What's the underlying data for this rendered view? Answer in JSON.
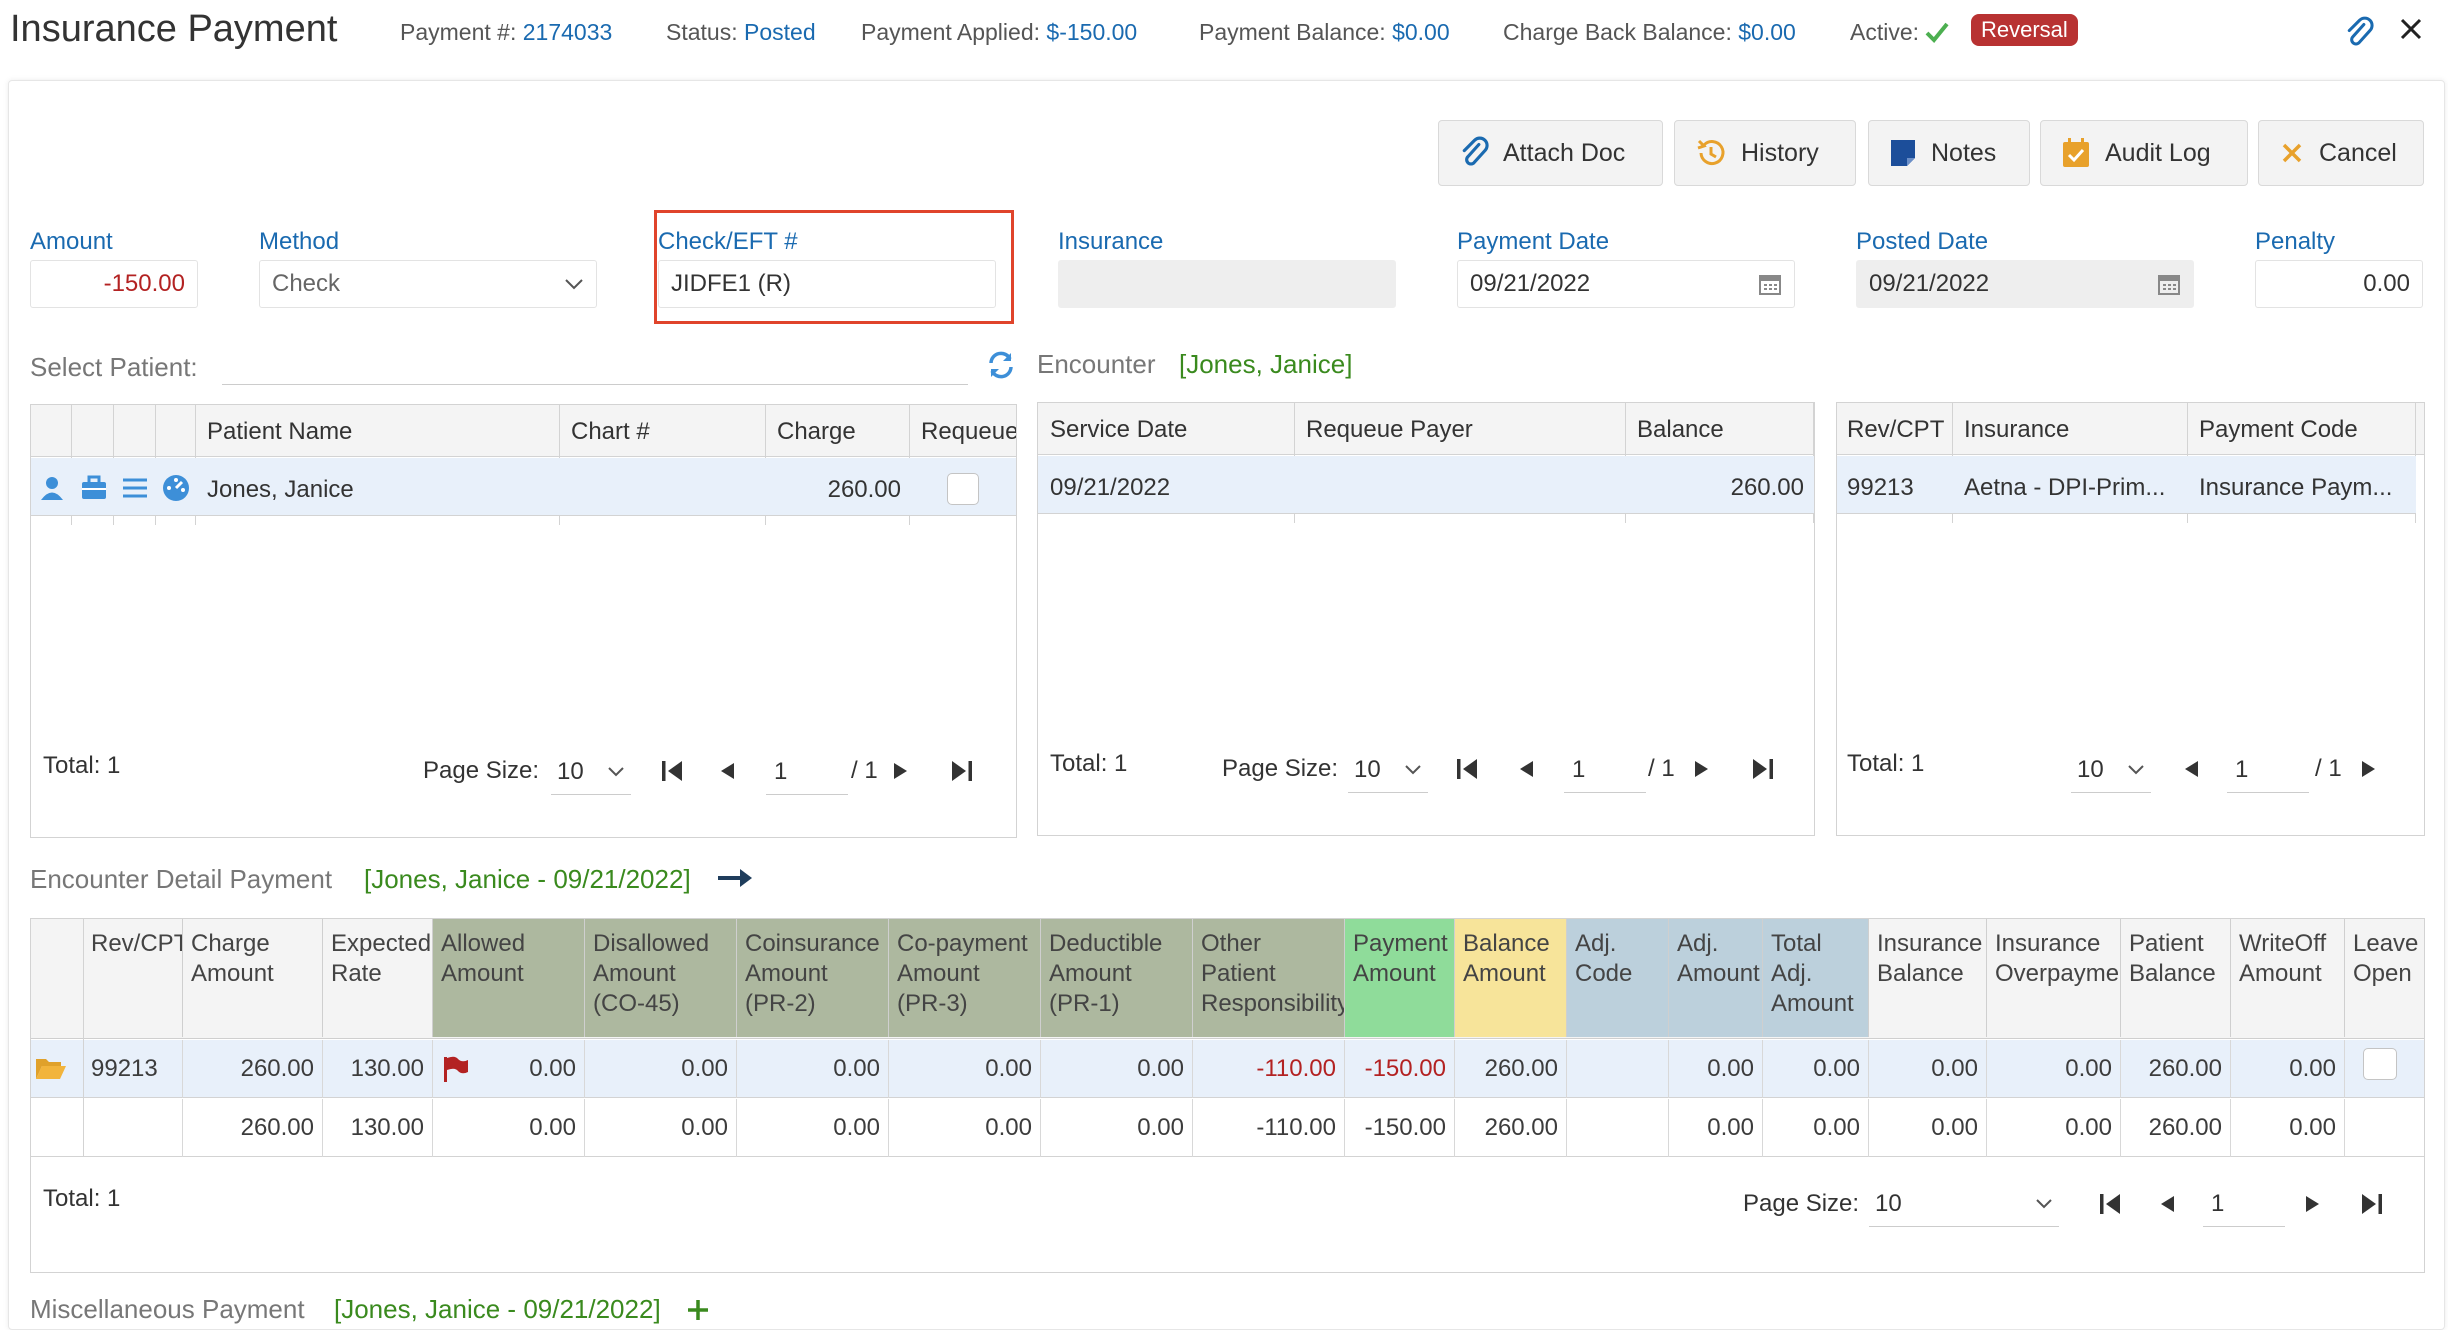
{
  "header": {
    "title": "Insurance Payment",
    "payment_no_label": "Payment #:",
    "payment_no": "2174033",
    "status_label": "Status:",
    "status": "Posted",
    "applied_label": "Payment Applied:",
    "applied": "$-150.00",
    "balance_label": "Payment Balance:",
    "balance": "$0.00",
    "chargeback_label": "Charge Back Balance:",
    "chargeback": "$0.00",
    "active_label": "Active:",
    "reversal": "Reversal"
  },
  "toolbar": {
    "attach": "Attach Doc",
    "history": "History",
    "notes": "Notes",
    "audit": "Audit Log",
    "cancel": "Cancel"
  },
  "form": {
    "amount_label": "Amount",
    "amount": "-150.00",
    "method_label": "Method",
    "method": "Check",
    "check_label": "Check/EFT #",
    "check": "JIDFE1 (R)",
    "insurance_label": "Insurance",
    "insurance": "",
    "payment_date_label": "Payment Date",
    "payment_date": "09/21/2022",
    "posted_date_label": "Posted Date",
    "posted_date": "09/21/2022",
    "penalty_label": "Penalty",
    "penalty": "0.00"
  },
  "patient": {
    "select_label": "Select Patient:",
    "headers": [
      "Patient Name",
      "Chart #",
      "Charge",
      "Requeue"
    ],
    "row": {
      "name": "Jones, Janice",
      "chart": "",
      "charge": "260.00"
    },
    "total": "Total: 1",
    "page_size_label": "Page Size:",
    "page_size": "10",
    "page": "1",
    "pages": "/ 1"
  },
  "encounter": {
    "label": "Encounter",
    "patient": "[Jones, Janice]",
    "headers": [
      "Service Date",
      "Requeue Payer",
      "Balance"
    ],
    "row": {
      "date": "09/21/2022",
      "payer": "",
      "balance": "260.00"
    },
    "total": "Total: 1",
    "page_size_label": "Page Size:",
    "page_size": "10",
    "page": "1",
    "pages": "/ 1"
  },
  "codes": {
    "headers": [
      "Rev/CPT",
      "Insurance",
      "Payment Code"
    ],
    "row": {
      "cpt": "99213",
      "insurance": "Aetna - DPI-Prim...",
      "code": "Insurance Paym..."
    },
    "total": "Total: 1",
    "page_size": "10",
    "page": "1",
    "pages": "/ 1"
  },
  "detail": {
    "label": "Encounter Detail Payment",
    "patient": "[Jones, Janice - 09/21/2022]",
    "headers": [
      "Rev/CPT",
      "Charge Amount",
      "Expected Rate",
      "Allowed Amount",
      "Disallowed Amount (CO-45)",
      "Coinsurance Amount (PR-2)",
      "Co-payment Amount (PR-3)",
      "Deductible Amount (PR-1)",
      "Other Patient Responsibility",
      "Payment Amount",
      "Balance Amount",
      "Adj. Code",
      "Adj. Amount",
      "Total Adj. Amount",
      "Insurance Balance",
      "Insurance Overpayment",
      "Patient Balance",
      "WriteOff Amount",
      "Leave Open"
    ],
    "row": [
      "99213",
      "260.00",
      "130.00",
      "0.00",
      "0.00",
      "0.00",
      "0.00",
      "0.00",
      "-110.00",
      "-150.00",
      "260.00",
      "",
      "0.00",
      "0.00",
      "0.00",
      "0.00",
      "260.00",
      "0.00",
      ""
    ],
    "totals": [
      "",
      "260.00",
      "130.00",
      "0.00",
      "0.00",
      "0.00",
      "0.00",
      "0.00",
      "-110.00",
      "-150.00",
      "260.00",
      "",
      "0.00",
      "0.00",
      "0.00",
      "0.00",
      "260.00",
      "0.00",
      ""
    ],
    "total": "Total: 1",
    "page_size_label": "Page Size:",
    "page_size": "10",
    "page": "1"
  },
  "misc": {
    "label": "Miscellaneous Payment",
    "patient": "[Jones, Janice - 09/21/2022]"
  },
  "colors": {
    "accent": "#1a6ab0",
    "green": "#3a8a1e",
    "red": "#b32222",
    "highlight_box": "#e0442b",
    "allowed_bg": "#adb89f",
    "payment_bg": "#8fdc9a",
    "balance_bg": "#f7e49a",
    "adj_bg": "#bcd0dc"
  }
}
